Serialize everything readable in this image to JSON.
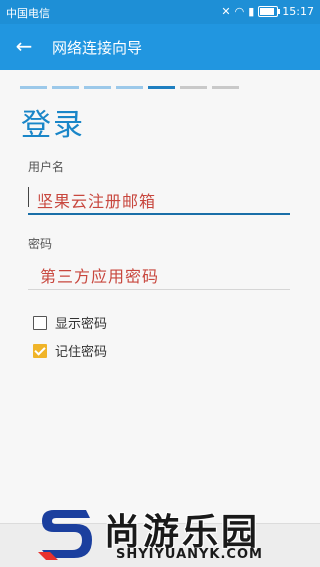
{
  "status_bar": {
    "carrier": "中国电信",
    "time": "15:17",
    "battery_level": 0.85
  },
  "app_bar": {
    "title": "网络连接向导",
    "back_icon": "arrow-left-icon"
  },
  "wizard": {
    "step_count": 7,
    "current_step": 5
  },
  "page": {
    "heading": "登录"
  },
  "form": {
    "username": {
      "label": "用户名",
      "value": "坚果云注册邮箱"
    },
    "password": {
      "label": "密码",
      "value": "第三方应用密码"
    },
    "show_password": {
      "label": "显示密码",
      "checked": false
    },
    "remember_password": {
      "label": "记住密码",
      "checked": true
    }
  },
  "watermark": {
    "name": "尚游乐园",
    "url": "SHYIYUANYK.COM"
  },
  "colors": {
    "accent": "#2196e0",
    "heading": "#1a86c8",
    "checkbox": "#f0b428",
    "value_text": "#c8473e"
  }
}
